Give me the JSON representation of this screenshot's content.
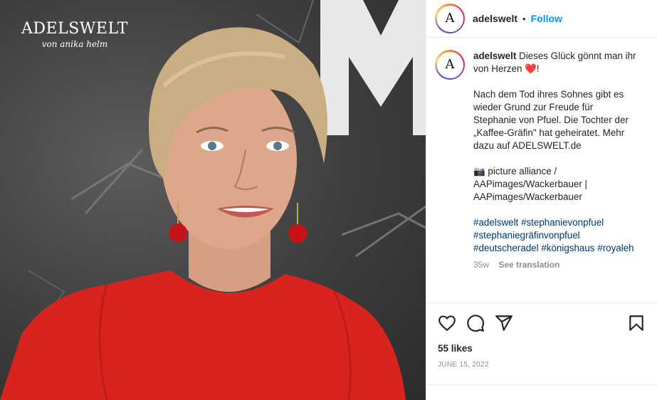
{
  "photo": {
    "brand_name": "ADELSWELT",
    "brand_sub": "von anika helm"
  },
  "header": {
    "username": "adelswelt",
    "separator": "•",
    "follow_label": "Follow",
    "avatar_letter": "A"
  },
  "caption": {
    "username": "adelswelt",
    "line1": "Dieses Glück gönnt man ihr",
    "line2_prefix": "von Herzen ",
    "heart": "❤️",
    "line2_suffix": "!",
    "body_lines": [
      "Nach dem Tod ihres Sohnes gibt es",
      "wieder Grund zur Freude für",
      "Stephanie von Pfuel. Die Tochter der",
      "„Kaffee-Gräfin\" hat geheiratet. Mehr",
      "dazu auf ADELSWELT.de"
    ],
    "credit_lines": [
      "📷 picture alliance /",
      "AAPimages/Wackerbauer |",
      "AAPimages/Wackerbauer"
    ],
    "hashtags": [
      "#adelswelt",
      "#stephanievonpfuel",
      "#stephaniegräfinvonpfuel",
      "#deutscheradel",
      "#königshaus",
      "#royaleh"
    ],
    "age": "35w",
    "see_translation": "See translation"
  },
  "actions": {
    "like_icon": "heart-outline-icon",
    "comment_icon": "comment-icon",
    "share_icon": "paper-plane-icon",
    "save_icon": "bookmark-icon"
  },
  "likes_text": "55 likes",
  "date_text": "JUNE 15, 2022",
  "colors": {
    "link_blue": "#0095f6",
    "hashtag": "#00376b",
    "muted": "#8e8e8e",
    "dress_red": "#d8231f"
  }
}
